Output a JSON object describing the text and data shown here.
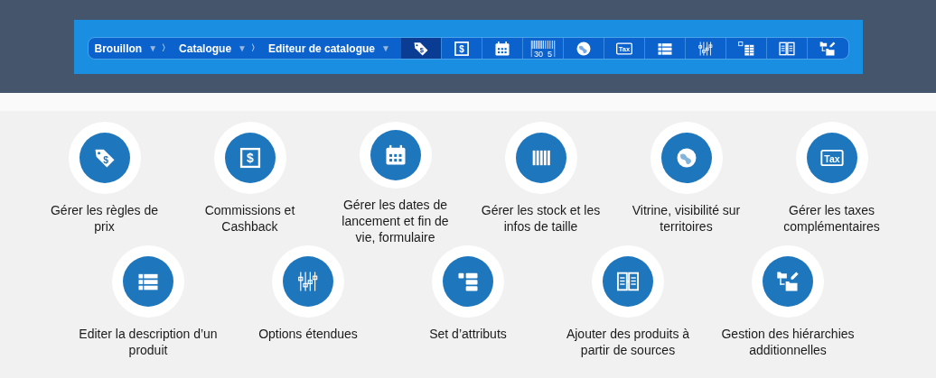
{
  "toolbar": {
    "breadcrumbs": [
      {
        "label": "Brouillon",
        "caret": "▼",
        "separator": "〉"
      },
      {
        "label": "Catalogue",
        "caret": "▼",
        "separator": "〉"
      },
      {
        "label": "Editeur de catalogue",
        "caret": "▼"
      }
    ],
    "tools": [
      {
        "kind": "price-tag",
        "text": "$",
        "selected": true
      },
      {
        "kind": "dollar-box",
        "text": "$",
        "selected": false
      },
      {
        "kind": "calendar",
        "selected": false
      },
      {
        "kind": "barcode",
        "text": "30",
        "text2": "5",
        "selected": false
      },
      {
        "kind": "globe",
        "selected": false
      },
      {
        "kind": "tax",
        "text": "Tax",
        "selected": false
      },
      {
        "kind": "list",
        "selected": false
      },
      {
        "kind": "sliders",
        "selected": false
      },
      {
        "kind": "columns",
        "selected": false
      },
      {
        "kind": "documents",
        "selected": false
      },
      {
        "kind": "hierarchy",
        "selected": false
      }
    ]
  },
  "features": [
    {
      "kind": "price-tag",
      "text": "$",
      "label": "Gérer les règles de prix"
    },
    {
      "kind": "dollar-box",
      "text": "$",
      "label": "Commissions et Cashback"
    },
    {
      "kind": "calendar",
      "label": "Gérer les dates de lancement et fin de vie, formulaire"
    },
    {
      "kind": "stock",
      "label": "Gérer les stock et les infos de taille"
    },
    {
      "kind": "globe",
      "label": "Vitrine, visibilité sur territoires"
    },
    {
      "kind": "tax",
      "text": "Tax",
      "label": "Gérer les taxes complémentaires"
    },
    {
      "kind": "list",
      "label": "Editer la description d’un produit"
    },
    {
      "kind": "sliders",
      "label": "Options étendues"
    },
    {
      "kind": "attributes",
      "label": "Set d’attributs"
    },
    {
      "kind": "documents",
      "label": "Ajouter des produits à partir de sources"
    },
    {
      "kind": "hierarchy",
      "label": "Gestion des hiérarchies additionnelles"
    }
  ]
}
